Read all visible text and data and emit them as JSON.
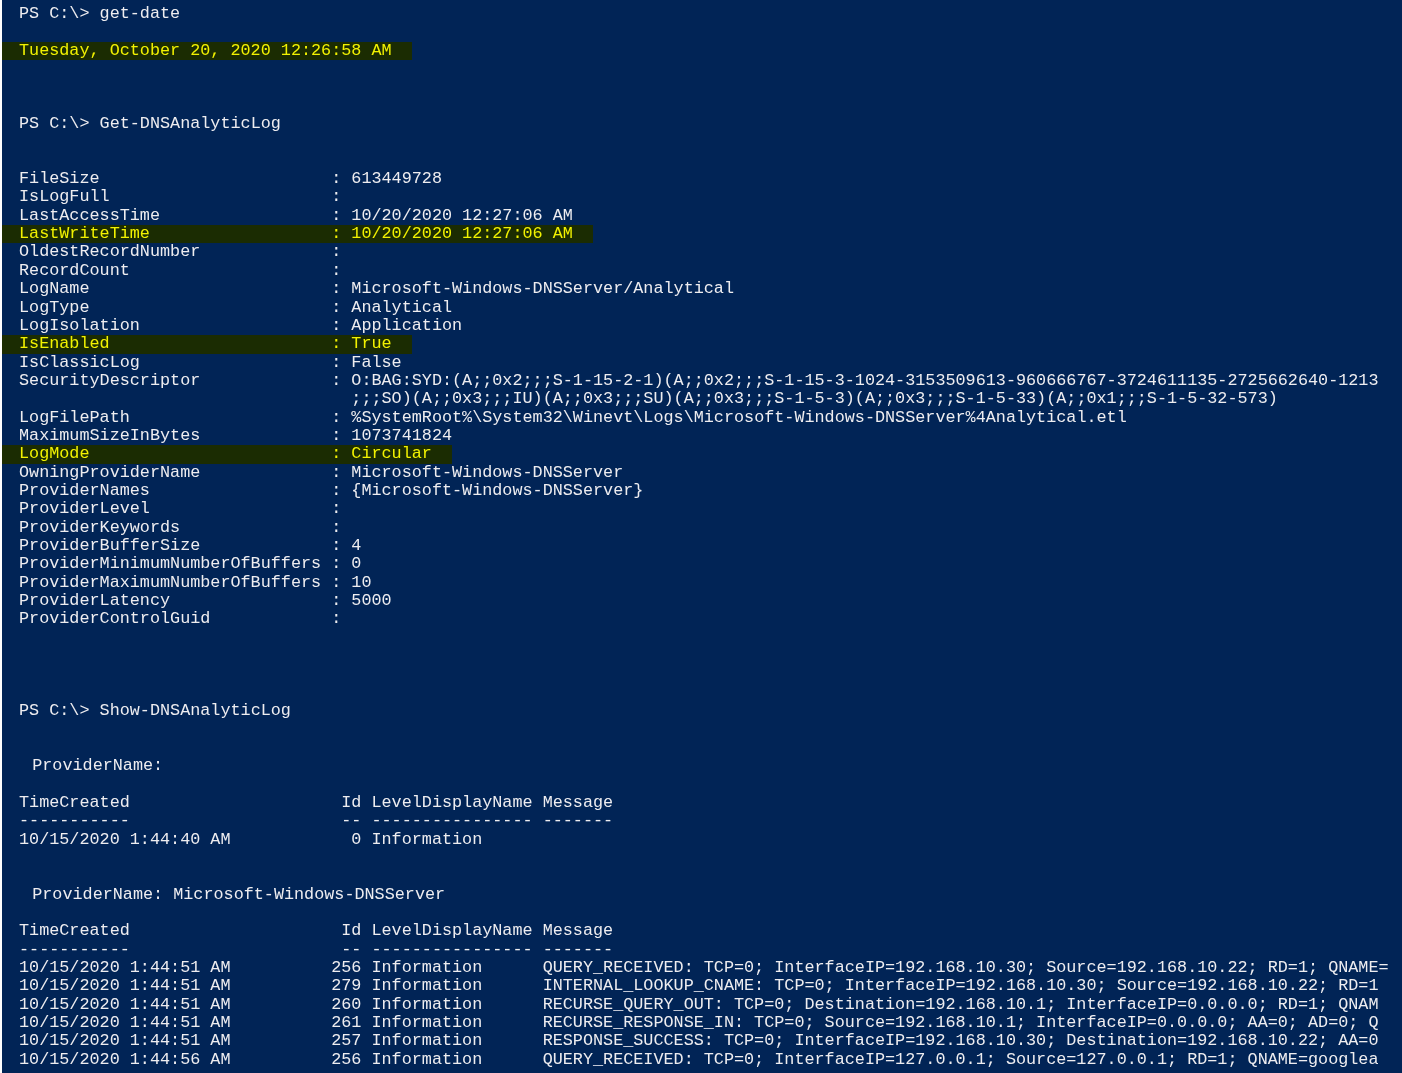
{
  "console": {
    "blocks": [
      {
        "kind": "command",
        "prompt": "PS C:\\>",
        "command": "get-date"
      },
      {
        "kind": "output",
        "text": "Tuesday, October 20, 2020 12:26:58 AM",
        "highlighted": true
      },
      {
        "kind": "command",
        "prompt": "PS C:\\>",
        "command": "Get-DNSAnalyticLog"
      },
      {
        "kind": "properties",
        "items": [
          {
            "name": "FileSize",
            "separator": ":",
            "value": "613449728",
            "highlighted": false
          },
          {
            "name": "IsLogFull",
            "separator": ":",
            "highlighted": false
          },
          {
            "name": "LastAccessTime",
            "separator": ":",
            "value": "10/20/2020 12:27:06 AM",
            "highlighted": false
          },
          {
            "name": "LastWriteTime",
            "separator": ":",
            "value": "10/20/2020 12:27:06 AM",
            "highlighted": true
          },
          {
            "name": "OldestRecordNumber",
            "separator": ":",
            "highlighted": false
          },
          {
            "name": "RecordCount",
            "separator": ":",
            "highlighted": false
          },
          {
            "name": "LogName",
            "separator": ":",
            "value": "Microsoft-Windows-DNSServer/Analytical",
            "highlighted": false
          },
          {
            "name": "LogType",
            "separator": ":",
            "value": "Analytical",
            "highlighted": false
          },
          {
            "name": "LogIsolation",
            "separator": ":",
            "value": "Application",
            "highlighted": false
          },
          {
            "name": "IsEnabled",
            "separator": ":",
            "value": "True",
            "highlighted": true
          },
          {
            "name": "IsClassicLog",
            "separator": ":",
            "value": "False",
            "highlighted": false
          },
          {
            "name": "SecurityDescriptor",
            "separator": ":",
            "value_lines": [
              "O:BAG:SYD:(A;;0x2;;;S-1-15-2-1)(A;;0x2;;;S-1-15-3-1024-3153509613-960666767-3724611135-2725662640-1213",
              ";;;SO)(A;;0x3;;;IU)(A;;0x3;;;SU)(A;;0x3;;;S-1-5-3)(A;;0x3;;;S-1-5-33)(A;;0x1;;;S-1-5-32-573)"
            ],
            "highlighted": false
          },
          {
            "name": "LogFilePath",
            "separator": ":",
            "value": "%SystemRoot%\\System32\\Winevt\\Logs\\Microsoft-Windows-DNSServer%4Analytical.etl",
            "highlighted": false
          },
          {
            "name": "MaximumSizeInBytes",
            "separator": ":",
            "value": "1073741824",
            "highlighted": false
          },
          {
            "name": "LogMode",
            "separator": ":",
            "value": "Circular",
            "highlighted": true
          },
          {
            "name": "OwningProviderName",
            "separator": ":",
            "value": "Microsoft-Windows-DNSServer",
            "highlighted": false
          },
          {
            "name": "ProviderNames",
            "separator": ":",
            "value": "{Microsoft-Windows-DNSServer}",
            "highlighted": false
          },
          {
            "name": "ProviderLevel",
            "separator": ":",
            "highlighted": false
          },
          {
            "name": "ProviderKeywords",
            "separator": ":",
            "highlighted": false
          },
          {
            "name": "ProviderBufferSize",
            "separator": ":",
            "value": "4",
            "highlighted": false
          },
          {
            "name": "ProviderMinimumNumberOfBuffers",
            "separator": ":",
            "value": "0",
            "highlighted": false
          },
          {
            "name": "ProviderMaximumNumberOfBuffers",
            "separator": ":",
            "value": "10",
            "highlighted": false
          },
          {
            "name": "ProviderLatency",
            "separator": ":",
            "value": "5000",
            "highlighted": false
          },
          {
            "name": "ProviderControlGuid",
            "separator": ":",
            "highlighted": false
          }
        ]
      },
      {
        "kind": "command",
        "prompt": "PS C:\\>",
        "command": "Show-DNSAnalyticLog"
      },
      {
        "kind": "group",
        "provider_label": "ProviderName:",
        "columns": [
          {
            "header": "TimeCreated",
            "rule": "-----------"
          },
          {
            "header": "Id",
            "rule": "--"
          },
          {
            "header": "LevelDisplayName",
            "rule": "----------------"
          },
          {
            "header": "Message",
            "rule": "-------"
          }
        ],
        "rows": [
          {
            "time": "10/15/2020 1:44:40 AM",
            "id": "0",
            "level": "Information"
          }
        ]
      },
      {
        "kind": "group",
        "provider_label": "ProviderName:",
        "provider": "Microsoft-Windows-DNSServer",
        "columns": [
          {
            "header": "TimeCreated",
            "rule": "-----------"
          },
          {
            "header": "Id",
            "rule": "--"
          },
          {
            "header": "LevelDisplayName",
            "rule": "----------------"
          },
          {
            "header": "Message",
            "rule": "-------"
          }
        ],
        "rows": [
          {
            "time": "10/15/2020 1:44:51 AM",
            "id": "256",
            "level": "Information",
            "message": "QUERY_RECEIVED: TCP=0; InterfaceIP=192.168.10.30; Source=192.168.10.22; RD=1; QNAME="
          },
          {
            "time": "10/15/2020 1:44:51 AM",
            "id": "279",
            "level": "Information",
            "message": "INTERNAL_LOOKUP_CNAME: TCP=0; InterfaceIP=192.168.10.30; Source=192.168.10.22; RD=1"
          },
          {
            "time": "10/15/2020 1:44:51 AM",
            "id": "260",
            "level": "Information",
            "message": "RECURSE_QUERY_OUT: TCP=0; Destination=192.168.10.1; InterfaceIP=0.0.0.0; RD=1; QNAM"
          },
          {
            "time": "10/15/2020 1:44:51 AM",
            "id": "261",
            "level": "Information",
            "message": "RECURSE_RESPONSE_IN: TCP=0; Source=192.168.10.1; InterfaceIP=0.0.0.0; AA=0; AD=0; Q"
          },
          {
            "time": "10/15/2020 1:44:51 AM",
            "id": "257",
            "level": "Information",
            "message": "RESPONSE_SUCCESS: TCP=0; InterfaceIP=192.168.10.30; Destination=192.168.10.22; AA=0"
          },
          {
            "time": "10/15/2020 1:44:56 AM",
            "id": "256",
            "level": "Information",
            "message": "QUERY_RECEIVED: TCP=0; InterfaceIP=127.0.0.1; Source=127.0.0.1; RD=1; QNAME=googlea"
          }
        ]
      }
    ]
  }
}
